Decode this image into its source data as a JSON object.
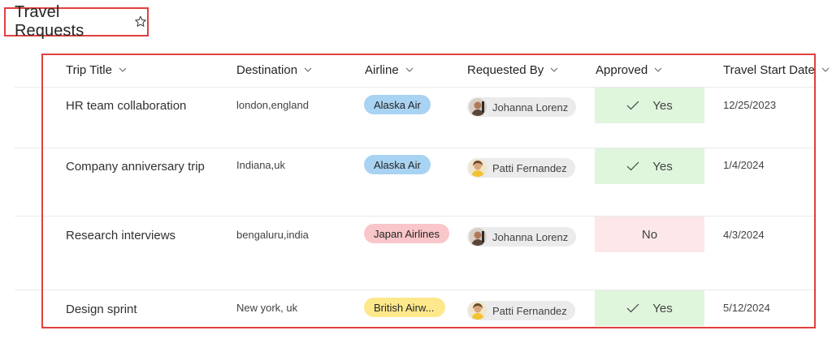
{
  "list": {
    "title": "Travel Requests",
    "favorite_icon": "star-outline-icon"
  },
  "columns": [
    {
      "label": "Trip Title"
    },
    {
      "label": "Destination"
    },
    {
      "label": "Airline"
    },
    {
      "label": "Requested By"
    },
    {
      "label": "Approved"
    },
    {
      "label": "Travel Start Date"
    }
  ],
  "rows": [
    {
      "trip_title": "HR team collaboration",
      "destination": "london,england",
      "airline": "Alaska Air",
      "requested_by": "Johanna Lorenz",
      "approved": "Yes",
      "travel_start_date": "12/25/2023"
    },
    {
      "trip_title": "Company anniversary trip",
      "destination": "Indiana,uk",
      "airline": "Alaska Air",
      "requested_by": "Patti Fernandez",
      "approved": "Yes",
      "travel_start_date": "1/4/2024"
    },
    {
      "trip_title": "Research interviews",
      "destination": "bengaluru,india",
      "airline": "Japan Airlines",
      "requested_by": "Johanna Lorenz",
      "approved": "No",
      "travel_start_date": "4/3/2024"
    },
    {
      "trip_title": "Design sprint",
      "destination": "New york, uk",
      "airline": "British Airw...",
      "requested_by": "Patti Fernandez",
      "approved": "Yes",
      "travel_start_date": "5/12/2024"
    }
  ],
  "colors": {
    "highlight_border": "#e0413f",
    "airline_alaska": "#a9d3f2",
    "airline_japan": "#f9c6c9",
    "airline_british": "#fde88c",
    "approved_yes_bg": "#dff6dd",
    "approved_no_bg": "#fde7e9",
    "person_chip_bg": "#ebebeb"
  }
}
